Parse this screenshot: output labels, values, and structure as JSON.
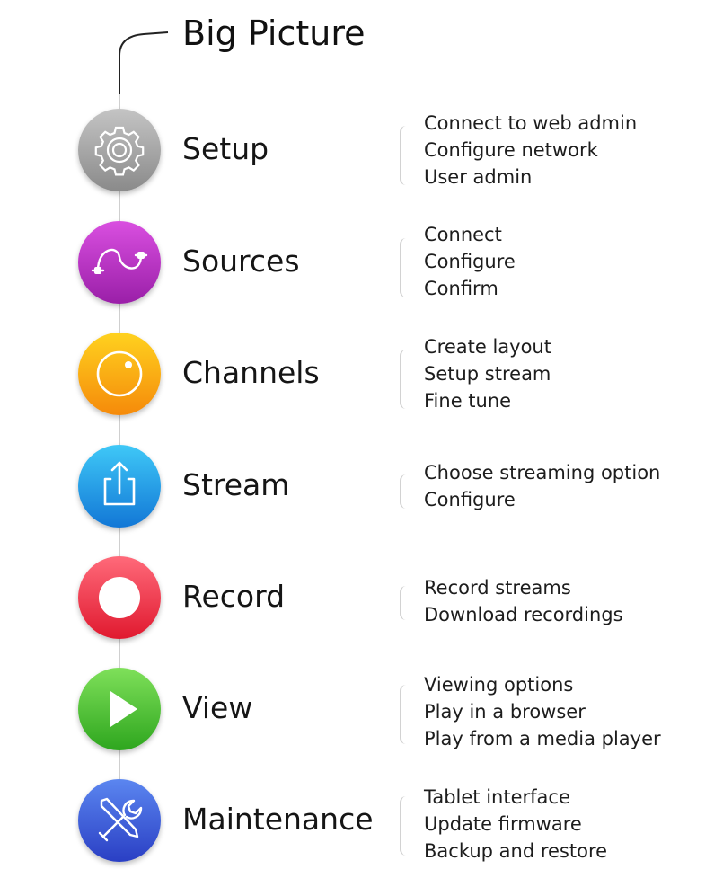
{
  "title": "Big Picture",
  "steps": [
    {
      "label": "Setup",
      "icon": "gear-icon",
      "color_top": "#c4c4c4",
      "color_bottom": "#8a8a8a",
      "tasks": [
        "Connect to web admin",
        "Configure network",
        "User admin"
      ]
    },
    {
      "label": "Sources",
      "icon": "cable-icon",
      "color_top": "#d94fe0",
      "color_bottom": "#9a1fa8",
      "tasks": [
        "Connect",
        "Configure",
        "Confirm"
      ]
    },
    {
      "label": "Channels",
      "icon": "lens-icon",
      "color_top": "#ffd21f",
      "color_bottom": "#f58a0a",
      "tasks": [
        "Create layout",
        "Setup stream",
        "Fine tune"
      ]
    },
    {
      "label": "Stream",
      "icon": "share-icon",
      "color_top": "#3fc8f7",
      "color_bottom": "#1277d6",
      "tasks": [
        "Choose streaming option",
        "Configure"
      ]
    },
    {
      "label": "Record",
      "icon": "record-icon",
      "color_top": "#ff6a7a",
      "color_bottom": "#e0192f",
      "tasks": [
        "Record streams",
        "Download recordings"
      ]
    },
    {
      "label": "View",
      "icon": "play-icon",
      "color_top": "#7fe05a",
      "color_bottom": "#2ea61e",
      "tasks": [
        "Viewing options",
        "Play in a browser",
        "Play from a media player"
      ]
    },
    {
      "label": "Maintenance",
      "icon": "tools-icon",
      "color_top": "#5b86f0",
      "color_bottom": "#2a3fc4",
      "tasks": [
        "Tablet interface",
        "Update firmware",
        "Backup and restore"
      ]
    }
  ]
}
